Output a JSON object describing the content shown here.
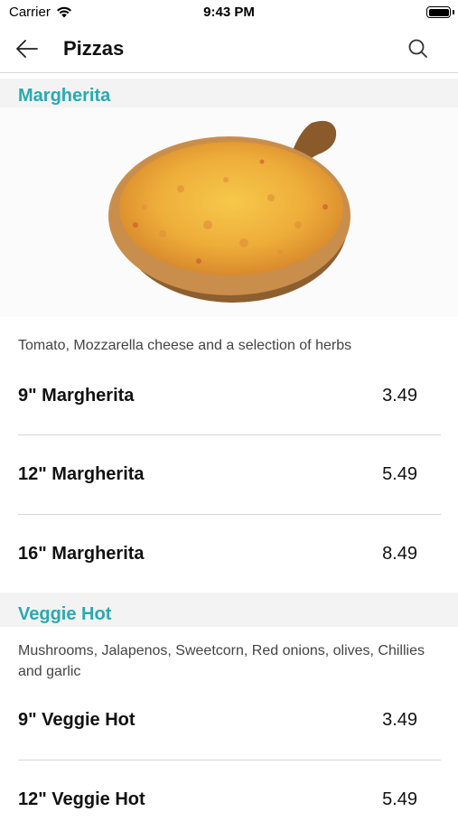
{
  "status_bar": {
    "carrier": "Carrier",
    "time": "9:43 PM"
  },
  "nav": {
    "title": "Pizzas",
    "back_icon": "arrow-left-icon",
    "search_icon": "search-icon"
  },
  "sections": [
    {
      "title": "Margherita",
      "image": "pizza-photo",
      "description": "Tomato, Mozzarella cheese and a selection of herbs",
      "items": [
        {
          "name": "9\" Margherita",
          "price": "3.49"
        },
        {
          "name": "12\" Margherita",
          "price": "5.49"
        },
        {
          "name": "16\" Margherita",
          "price": "8.49"
        }
      ]
    },
    {
      "title": "Veggie Hot",
      "description": "Mushrooms, Jalapenos, Sweetcorn, Red onions, olives, Chillies and garlic",
      "items": [
        {
          "name": "9\" Veggie Hot",
          "price": "3.49"
        },
        {
          "name": "12\" Veggie Hot",
          "price": "5.49"
        }
      ]
    }
  ],
  "colors": {
    "accent": "#2aa9b0",
    "section_bg": "#f3f3f3",
    "divider": "#d6d6d6"
  }
}
